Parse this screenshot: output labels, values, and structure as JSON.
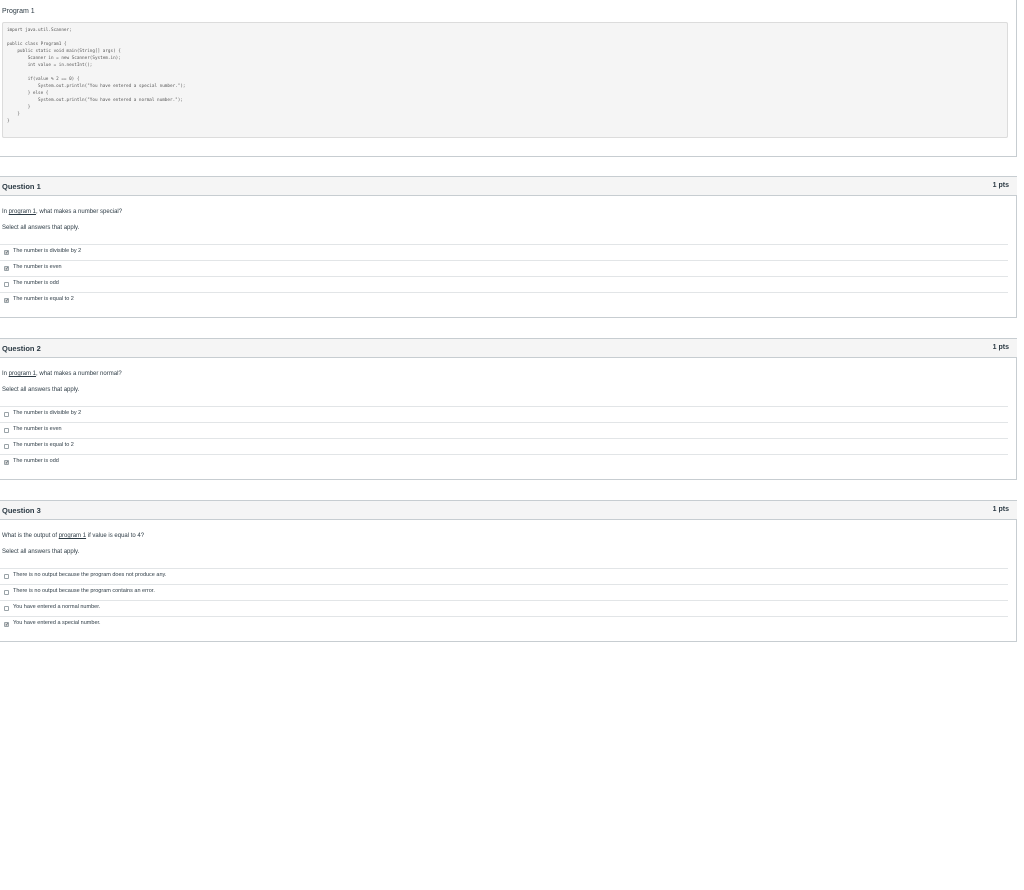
{
  "program": {
    "title": "Program 1",
    "code": "import java.util.Scanner;\n\npublic class Program1 {\n    public static void main(String[] args) {\n        Scanner in = new Scanner(System.in);\n        int value = in.nextInt();\n\n        if(value % 2 == 0) {\n            System.out.println(\"You have entered a special number.\");\n        } else {\n            System.out.println(\"You have entered a normal number.\");\n        }\n    }\n}"
  },
  "questions": [
    {
      "name": "Question 1",
      "points": "1 pts",
      "text_before": "In ",
      "link": "program 1",
      "text_after": ", what makes a number special?",
      "instruction": "Select all answers that apply.",
      "answers": [
        {
          "label": "The number is divisible by 2",
          "checked": true
        },
        {
          "label": "The number is even",
          "checked": true
        },
        {
          "label": "The number is odd",
          "checked": false
        },
        {
          "label": "The number is equal to 2",
          "checked": true
        }
      ]
    },
    {
      "name": "Question 2",
      "points": "1 pts",
      "text_before": "In ",
      "link": "program 1",
      "text_after": ", what makes a number normal?",
      "instruction": "Select all answers that apply.",
      "answers": [
        {
          "label": "The number is divisible by 2",
          "checked": false
        },
        {
          "label": "The number is even",
          "checked": false
        },
        {
          "label": "The number is equal to 2",
          "checked": false
        },
        {
          "label": "The number is odd",
          "checked": true
        }
      ]
    },
    {
      "name": "Question 3",
      "points": "1 pts",
      "text_before": "What is the output of ",
      "link": "program 1",
      "text_after": " if value is equal to 4?",
      "instruction": "Select all answers that apply.",
      "answers": [
        {
          "label": "There is no output because the program does not produce any.",
          "checked": false
        },
        {
          "label": "There is no output because the program contains an error.",
          "checked": false
        },
        {
          "label": "You have entered a normal number.",
          "checked": false
        },
        {
          "label": "You have entered a special number.",
          "checked": true
        }
      ]
    }
  ]
}
